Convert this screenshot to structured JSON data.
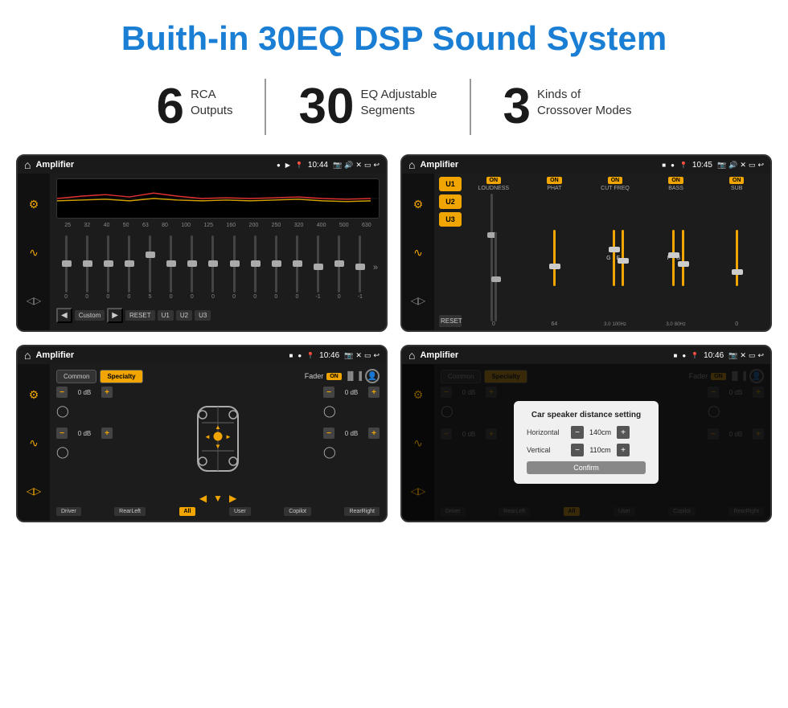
{
  "header": {
    "title": "Buith-in 30EQ DSP Sound System"
  },
  "stats": [
    {
      "number": "6",
      "label": "RCA\nOutputs"
    },
    {
      "number": "30",
      "label": "EQ Adjustable\nSegments"
    },
    {
      "number": "3",
      "label": "Kinds of\nCrossover Modes"
    }
  ],
  "screens": [
    {
      "id": "eq-screen",
      "statusBar": {
        "appName": "Amplifier",
        "time": "10:44"
      },
      "type": "equalizer"
    },
    {
      "id": "crossover-screen",
      "statusBar": {
        "appName": "Amplifier",
        "time": "10:45"
      },
      "type": "crossover"
    },
    {
      "id": "fader-screen",
      "statusBar": {
        "appName": "Amplifier",
        "time": "10:46"
      },
      "type": "fader"
    },
    {
      "id": "distance-screen",
      "statusBar": {
        "appName": "Amplifier",
        "time": "10:46"
      },
      "type": "distance"
    }
  ],
  "eq": {
    "freqLabels": [
      "25",
      "32",
      "40",
      "50",
      "63",
      "80",
      "100",
      "125",
      "160",
      "200",
      "250",
      "320",
      "400",
      "500",
      "630"
    ],
    "values": [
      "0",
      "0",
      "0",
      "0",
      "5",
      "0",
      "0",
      "0",
      "0",
      "0",
      "0",
      "0",
      "-1",
      "0",
      "-1"
    ],
    "presetLabel": "Custom",
    "buttons": [
      "RESET",
      "U1",
      "U2",
      "U3"
    ]
  },
  "crossover": {
    "bands": [
      "U1",
      "U2",
      "U3"
    ],
    "controls": [
      "LOUDNESS",
      "PHAT",
      "CUT FREQ",
      "BASS",
      "SUB"
    ],
    "resetLabel": "RESET"
  },
  "fader": {
    "tabs": [
      "Common",
      "Specialty"
    ],
    "activeTab": "Specialty",
    "faderLabel": "Fader",
    "onLabel": "ON",
    "db_vals": [
      "0 dB",
      "0 dB",
      "0 dB",
      "0 dB"
    ],
    "bottomBtns": [
      "Driver",
      "RearLeft",
      "All",
      "User",
      "Copilot",
      "RearRight"
    ]
  },
  "distance": {
    "title": "Car speaker distance setting",
    "horizontal": "140cm",
    "vertical": "110cm",
    "confirmLabel": "Confirm"
  }
}
